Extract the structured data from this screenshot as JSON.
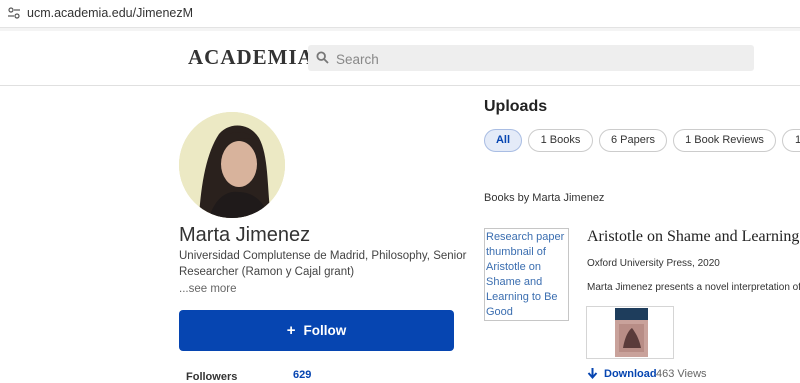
{
  "browser": {
    "url": "ucm.academia.edu/JimenezM"
  },
  "header": {
    "logo": "ACADEMIA",
    "search_placeholder": "Search"
  },
  "profile": {
    "name": "Marta Jimenez",
    "affiliation": "Universidad Complutense de Madrid, Philosophy, Senior Researcher (Ramon y Cajal grant)",
    "see_more": "...see more",
    "follow_label": "Follow",
    "stats": [
      {
        "label": "Followers",
        "value": "629"
      }
    ]
  },
  "uploads": {
    "title": "Uploads",
    "tabs": [
      {
        "label": "All",
        "active": true
      },
      {
        "label": "1 Books"
      },
      {
        "label": "6 Papers"
      },
      {
        "label": "1 Book Reviews"
      },
      {
        "label": "1"
      }
    ],
    "section_heading": "Books by Marta Jimenez",
    "items": [
      {
        "thumbnail_alt": "Research paper thumbnail of Aristotle on Shame and Learning to Be Good",
        "title": "Aristotle on Shame and Learning",
        "publisher": "Oxford University Press, 2020",
        "summary": "Marta Jimenez presents a novel interpretation of",
        "download_label": "Download",
        "views": "463 Views"
      }
    ]
  },
  "colors": {
    "accent": "#0645b1",
    "follow_bg": "#0645b1",
    "active_tab_bg": "#e4ebf8"
  },
  "icons": [
    "site-settings-icon",
    "search-icon",
    "plus-icon",
    "download-arrow-icon"
  ]
}
